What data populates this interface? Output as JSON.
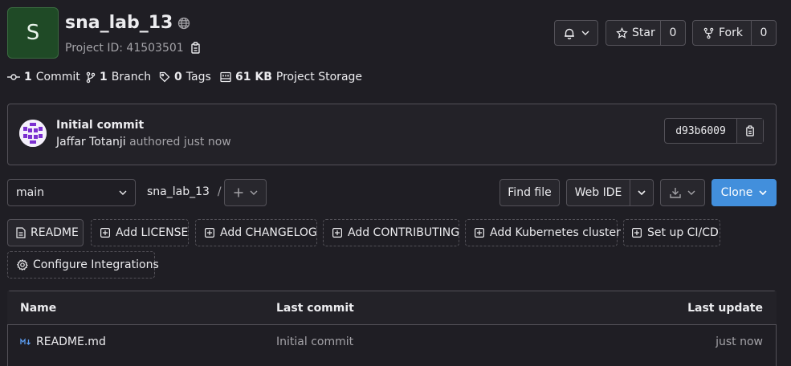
{
  "project": {
    "avatar_letter": "S",
    "name": "sna_lab_13",
    "id_label": "Project ID: 41503501",
    "visibility_icon": "globe-icon"
  },
  "header_actions": {
    "notification_icon": "bell-icon",
    "star_label": "Star",
    "star_count": "0",
    "fork_label": "Fork",
    "fork_count": "0"
  },
  "stats": {
    "commits_count": "1",
    "commits_label": "Commit",
    "branches_count": "1",
    "branches_label": "Branch",
    "tags_count": "0",
    "tags_label": "Tags",
    "storage_size": "61 KB",
    "storage_label": "Project Storage"
  },
  "last_commit": {
    "title": "Initial commit",
    "author": "Jaffar Totanji",
    "meta": "authored just now",
    "sha": "d93b6009"
  },
  "toolbar": {
    "branch": "main",
    "breadcrumb_project": "sna_lab_13",
    "breadcrumb_separator": "/",
    "find_file": "Find file",
    "web_ide": "Web IDE",
    "clone": "Clone"
  },
  "quick_actions": [
    {
      "label": "README"
    },
    {
      "label": "Add LICENSE"
    },
    {
      "label": "Add CHANGELOG"
    },
    {
      "label": "Add CONTRIBUTING"
    },
    {
      "label": "Add Kubernetes cluster"
    },
    {
      "label": "Set up CI/CD"
    },
    {
      "label": "Configure Integrations"
    }
  ],
  "file_table": {
    "headers": {
      "name": "Name",
      "last_commit": "Last commit",
      "last_update": "Last update"
    },
    "rows": [
      {
        "name": "README.md",
        "last_commit": "Initial commit",
        "last_update": "just now",
        "icon": "markdown-icon"
      }
    ]
  },
  "colors": {
    "background": "#1f1e24",
    "avatar_bg": "#1f4a26",
    "clone_button": "#428fdc",
    "border": "#535158"
  }
}
